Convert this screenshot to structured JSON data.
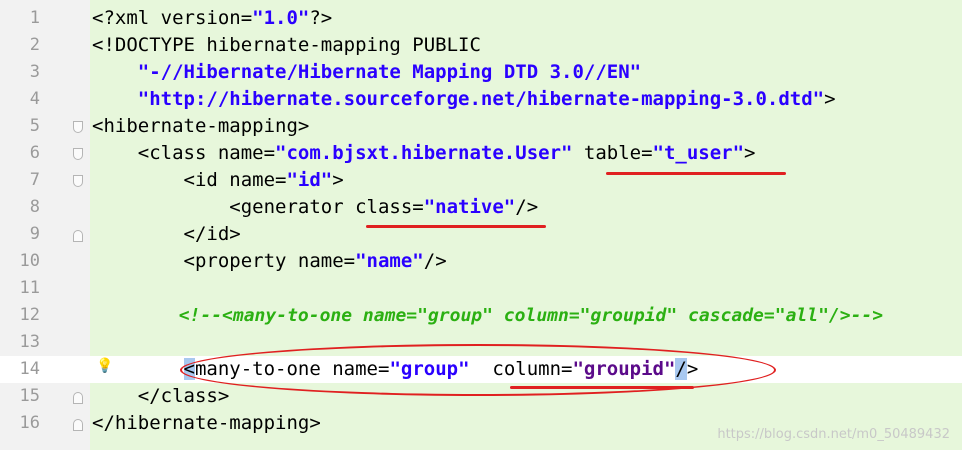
{
  "editor": {
    "line_numbers": [
      "1",
      "2",
      "3",
      "4",
      "5",
      "6",
      "7",
      "8",
      "9",
      "10",
      "11",
      "12",
      "13",
      "14",
      "15",
      "16"
    ],
    "lines": {
      "l1": {
        "a": "<?xml version=",
        "b": "\"1.0\"",
        "c": "?>"
      },
      "l2": {
        "a": "<!DOCTYPE hibernate-mapping PUBLIC"
      },
      "l3": {
        "a": "    ",
        "b": "\"-//Hibernate/Hibernate Mapping DTD 3.0//EN\""
      },
      "l4": {
        "a": "    ",
        "b": "\"http://hibernate.sourceforge.net/hibernate-mapping-3.0.dtd\"",
        "c": ">"
      },
      "l5": {
        "a": "<hibernate-mapping>"
      },
      "l6": {
        "a": "    <class name=",
        "b": "\"com.bjsxt.hibernate.User\"",
        "c": " table=",
        "d": "\"t_user\"",
        "e": ">"
      },
      "l7": {
        "a": "        <id name=",
        "b": "\"id\"",
        "c": ">"
      },
      "l8": {
        "a": "            <generator class=",
        "b": "\"native\"",
        "c": "/>"
      },
      "l9": {
        "a": "        </id>"
      },
      "l10": {
        "a": "        <property name=",
        "b": "\"name\"",
        "c": "/>"
      },
      "l11": {
        "a": ""
      },
      "l12": {
        "a": "        ",
        "b": "<!--<many-to-one name=\"group\" column=\"groupid\" cascade=\"all\"/>-->"
      },
      "l13": {
        "a": ""
      },
      "l14": {
        "a": "        ",
        "sel1": "<",
        "b": "many-to-one name=",
        "c": "\"group\"",
        "d": "  column=",
        "e": "\"groupid\"",
        "sel2": "/",
        "f": ">"
      },
      "l15": {
        "a": "    </class>"
      },
      "l16": {
        "a": "</hibernate-mapping>"
      }
    },
    "icons": {
      "intention": "lightbulb-icon",
      "fold": "fold-marker-icon"
    },
    "colors": {
      "string": "#2a00ff",
      "comment": "#2bb012",
      "annotation": "#e02020",
      "background": "#e7f7db"
    }
  },
  "watermark": "https://blog.csdn.net/m0_50489432"
}
